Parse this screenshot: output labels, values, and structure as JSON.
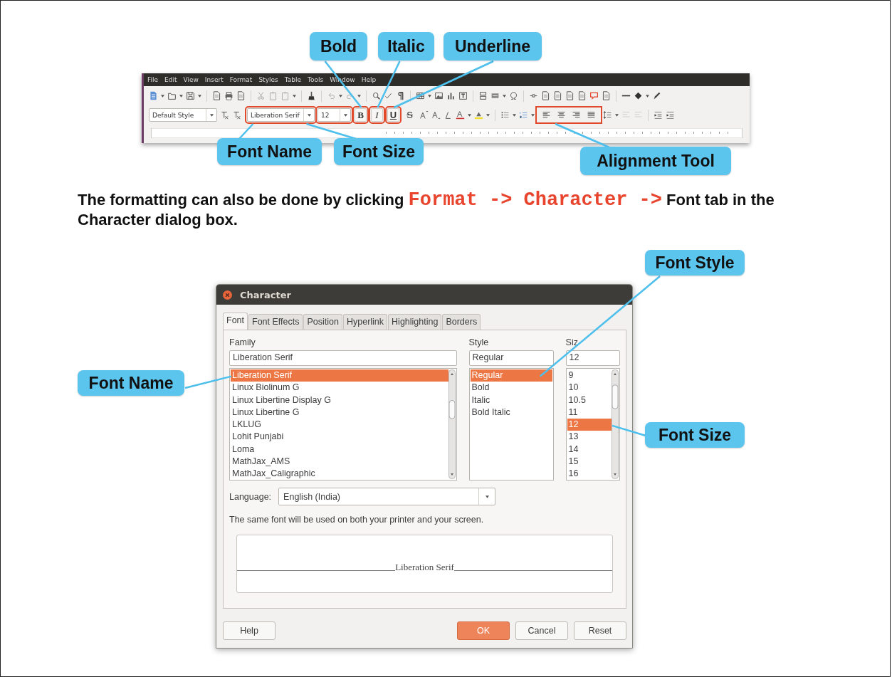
{
  "toolbar": {
    "menu": [
      "File",
      "Edit",
      "View",
      "Insert",
      "Format",
      "Styles",
      "Table",
      "Tools",
      "Window",
      "Help"
    ],
    "paragraph_style": "Default Style",
    "font_name": {
      "value": "Liberation Serif",
      "annotated": true
    },
    "font_size": {
      "value": "12",
      "annotated": true
    },
    "format_buttons": [
      {
        "label": "B",
        "kind": "bold",
        "annotated": true
      },
      {
        "label": "I",
        "kind": "italic",
        "annotated": true
      },
      {
        "label": "U",
        "kind": "underline",
        "annotated": true
      },
      {
        "label": "S",
        "kind": "strike",
        "annotated": false
      }
    ],
    "alignment_annotated": true
  },
  "toolbar_callouts": [
    {
      "text": "Bold"
    },
    {
      "text": "Italic"
    },
    {
      "text": "Underline"
    },
    {
      "text": "Font Name"
    },
    {
      "text": "Font Size"
    },
    {
      "text": "Alignment Tool"
    }
  ],
  "paragraph": [
    {
      "text": "The formatting can also be done by clicking ",
      "kind": "plain"
    },
    {
      "text": "Format -> Character ->",
      "kind": "code"
    },
    {
      "text": " Font tab in the Character dialog box.",
      "kind": "plain"
    }
  ],
  "dialog": {
    "title": "Character",
    "tabs": [
      {
        "label": "Font",
        "selected": true
      },
      {
        "label": "Font Effects",
        "selected": false
      },
      {
        "label": "Position",
        "selected": false
      },
      {
        "label": "Hyperlink",
        "selected": false
      },
      {
        "label": "Highlighting",
        "selected": false
      },
      {
        "label": "Borders",
        "selected": false
      }
    ],
    "family": {
      "label": "Family",
      "value": "Liberation Serif",
      "items": [
        {
          "text": "Liberation Serif",
          "selected": true
        },
        {
          "text": "Linux Biolinum G",
          "selected": false
        },
        {
          "text": "Linux Libertine Display G",
          "selected": false
        },
        {
          "text": "Linux Libertine G",
          "selected": false
        },
        {
          "text": "LKLUG",
          "selected": false
        },
        {
          "text": "Lohit Punjabi",
          "selected": false
        },
        {
          "text": "Loma",
          "selected": false
        },
        {
          "text": "MathJax_AMS",
          "selected": false
        },
        {
          "text": "MathJax_Caligraphic",
          "selected": false
        }
      ]
    },
    "style": {
      "label": "Style",
      "value": "Regular",
      "items": [
        {
          "text": "Regular",
          "selected": true
        },
        {
          "text": "Bold",
          "selected": false
        },
        {
          "text": "Italic",
          "selected": false
        },
        {
          "text": "Bold Italic",
          "selected": false
        }
      ]
    },
    "size": {
      "label": "Siz",
      "value": "12",
      "items": [
        {
          "text": "9",
          "selected": false
        },
        {
          "text": "10",
          "selected": false
        },
        {
          "text": "10.5",
          "selected": false
        },
        {
          "text": "11",
          "selected": false
        },
        {
          "text": "12",
          "selected": true
        },
        {
          "text": "13",
          "selected": false
        },
        {
          "text": "14",
          "selected": false
        },
        {
          "text": "15",
          "selected": false
        },
        {
          "text": "16",
          "selected": false
        }
      ]
    },
    "language": {
      "label": "Language:",
      "value": "English (India)"
    },
    "note": "The same font will be used on both your printer and your screen.",
    "preview": "Liberation Serif",
    "buttons": [
      {
        "label": "Help",
        "default": false
      },
      {
        "label": "OK",
        "default": true
      },
      {
        "label": "Cancel",
        "default": false
      },
      {
        "label": "Reset",
        "default": false
      }
    ]
  },
  "dialog_callouts": [
    {
      "text": "Font Style"
    },
    {
      "text": "Font Name"
    },
    {
      "text": "Font Size"
    }
  ]
}
